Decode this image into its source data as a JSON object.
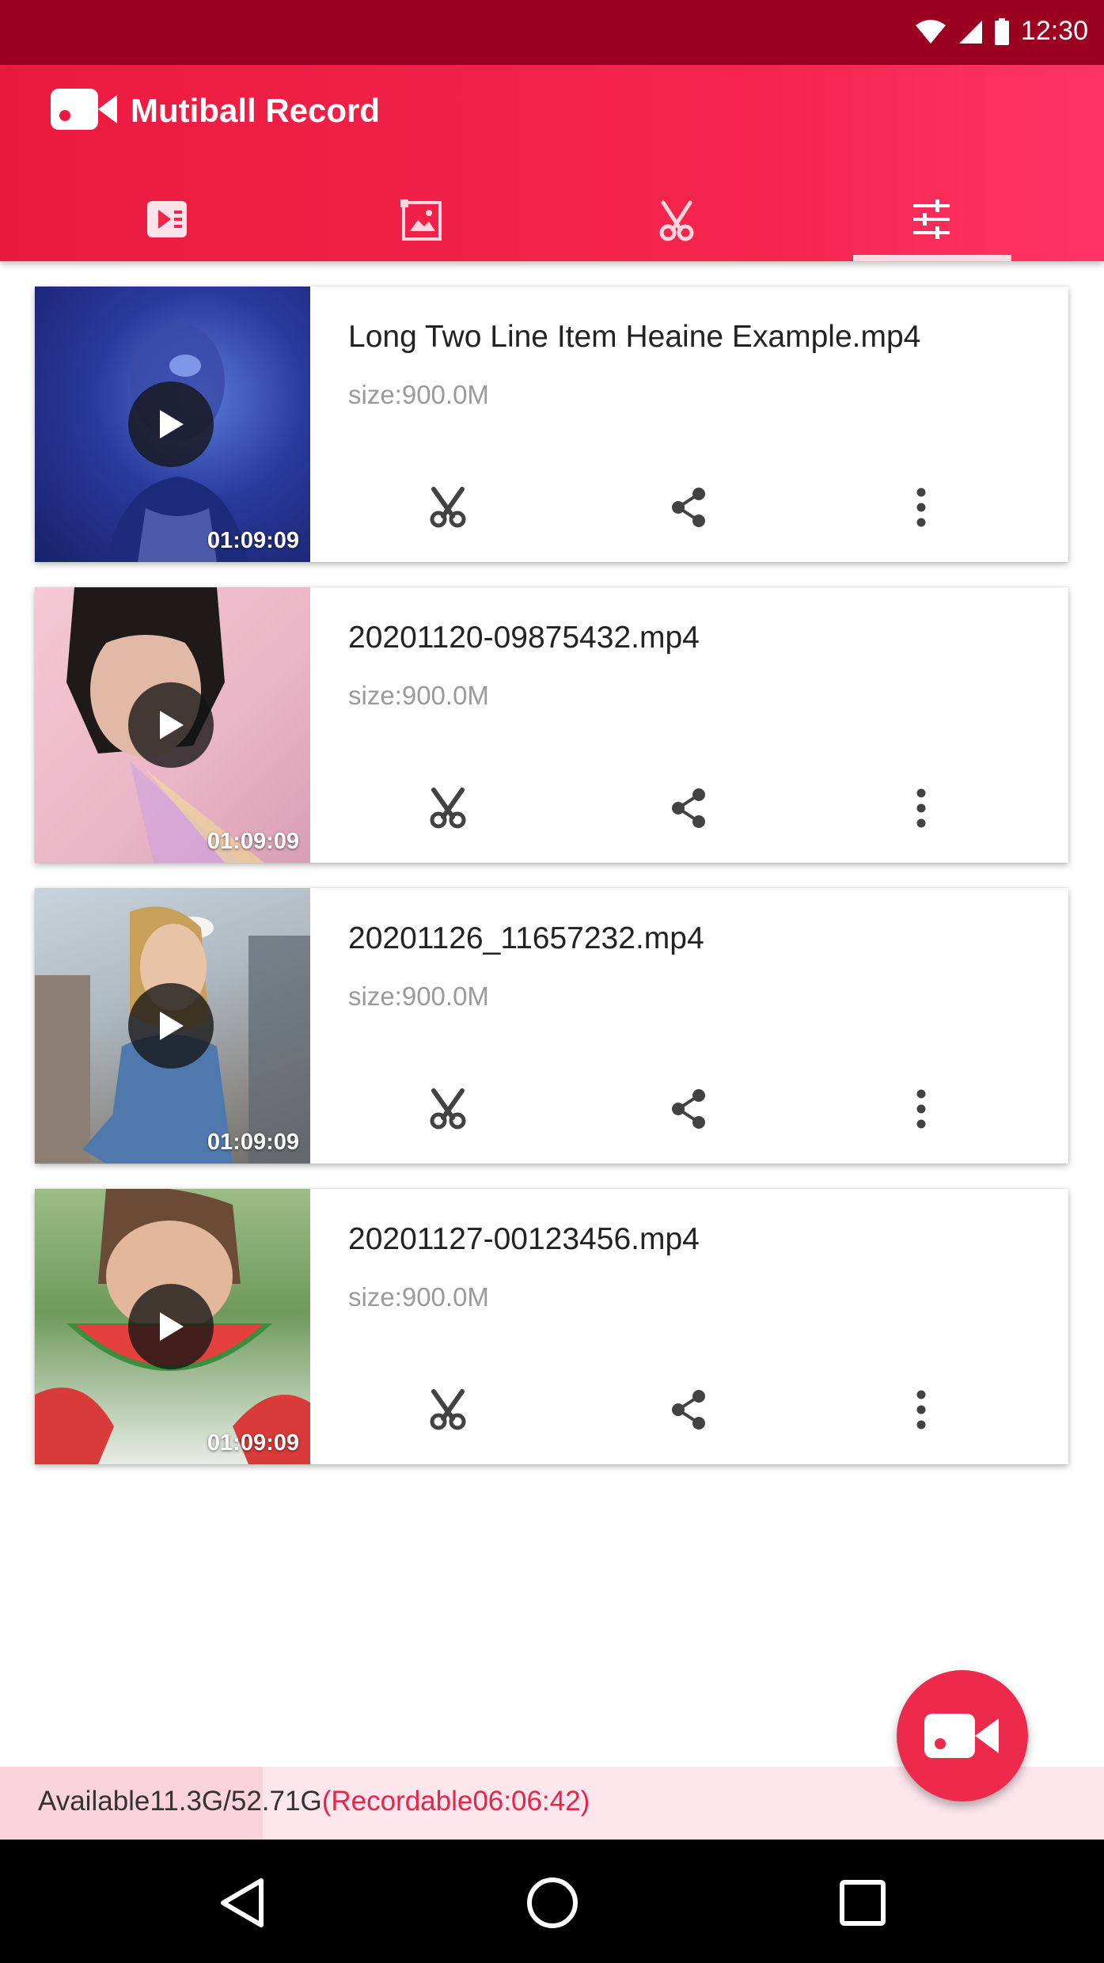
{
  "status_bar": {
    "time": "12:30"
  },
  "app": {
    "title": "Mutiball Record"
  },
  "tabs": [
    {
      "name": "videos",
      "icon": "video-list-icon"
    },
    {
      "name": "images",
      "icon": "image-icon"
    },
    {
      "name": "edit",
      "icon": "scissors-icon"
    },
    {
      "name": "settings",
      "icon": "tune-icon",
      "selected": true
    }
  ],
  "videos": [
    {
      "title": "Long Two Line Item Heaine Example.mp4",
      "size": "size:900.0M",
      "duration": "01:09:09"
    },
    {
      "title": "20201120-09875432.mp4",
      "size": "size:900.0M",
      "duration": "01:09:09"
    },
    {
      "title": "20201126_11657232.mp4",
      "size": "size:900.0M",
      "duration": "01:09:09"
    },
    {
      "title": "20201127-00123456.mp4",
      "size": "size:900.0M",
      "duration": "01:09:09"
    }
  ],
  "storage": {
    "available": "Available11.3G/52.71G",
    "recordable": "(Recordable06:06:42)"
  },
  "colors": {
    "accent": "#ee2a4c",
    "status_bar": "#9b0021"
  }
}
